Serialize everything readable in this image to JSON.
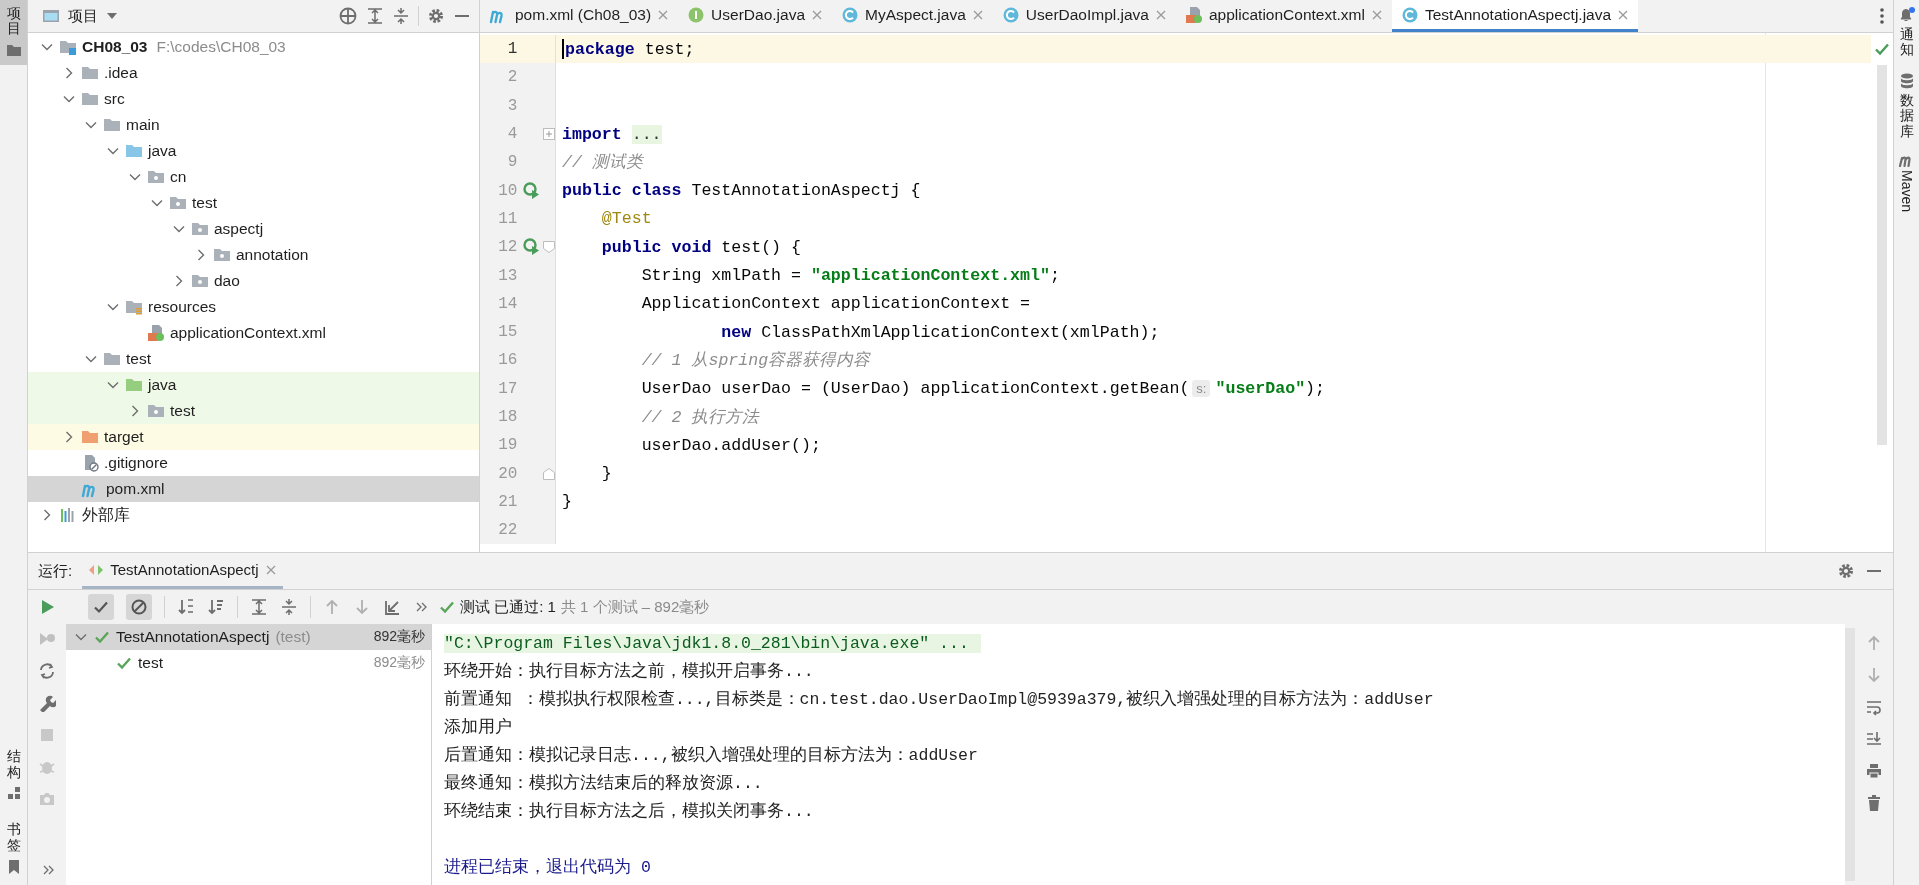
{
  "left_strip": {
    "top": [
      {
        "label": "项目",
        "selected": true
      }
    ],
    "bottom": [
      {
        "label": "结构",
        "kind": "structure",
        "selected": false
      },
      {
        "label": "书签",
        "kind": "bookmark",
        "selected": false
      }
    ]
  },
  "project": {
    "title": "项目",
    "tree": [
      {
        "label": "CH08_03",
        "hint": "F:\\codes\\CH08_03",
        "kind": "module",
        "expanded": true,
        "selected": false,
        "children": [
          {
            "label": ".idea",
            "kind": "folder",
            "expanded": false,
            "selected": false
          },
          {
            "label": "src",
            "kind": "folder",
            "expanded": true,
            "selected": false,
            "children": [
              {
                "label": "main",
                "kind": "folder",
                "expanded": true,
                "selected": false,
                "children": [
                  {
                    "label": "java",
                    "kind": "source-root",
                    "expanded": true,
                    "selected": false,
                    "children": [
                      {
                        "label": "cn",
                        "kind": "package",
                        "expanded": true,
                        "selected": false,
                        "children": [
                          {
                            "label": "test",
                            "kind": "package",
                            "expanded": true,
                            "selected": false,
                            "children": [
                              {
                                "label": "aspectj",
                                "kind": "package",
                                "expanded": true,
                                "selected": false,
                                "children": [
                                  {
                                    "label": "annotation",
                                    "kind": "package",
                                    "expanded": false,
                                    "selected": false
                                  }
                                ]
                              },
                              {
                                "label": "dao",
                                "kind": "package",
                                "expanded": false,
                                "selected": false
                              }
                            ]
                          }
                        ]
                      }
                    ]
                  },
                  {
                    "label": "resources",
                    "kind": "resources-root",
                    "expanded": true,
                    "selected": false,
                    "children": [
                      {
                        "label": "applicationContext.xml",
                        "kind": "spring-xml",
                        "selected": false
                      }
                    ]
                  }
                ]
              },
              {
                "label": "test",
                "kind": "folder",
                "expanded": true,
                "selected": false,
                "children": [
                  {
                    "label": "java",
                    "kind": "test-root",
                    "test_source": true,
                    "expanded": true,
                    "selected": false,
                    "children": [
                      {
                        "label": "test",
                        "kind": "package",
                        "test_source": true,
                        "expanded": false,
                        "selected": false
                      }
                    ]
                  }
                ]
              }
            ]
          },
          {
            "label": "target",
            "kind": "excluded",
            "excluded": true,
            "expanded": false,
            "selected": false
          },
          {
            "label": ".gitignore",
            "kind": "gitignore",
            "selected": false
          },
          {
            "label": "pom.xml",
            "kind": "maven",
            "selected": true
          }
        ]
      },
      {
        "label": "外部库",
        "kind": "library",
        "expanded": false,
        "selected": false
      }
    ]
  },
  "editor": {
    "tabs": [
      {
        "label": "pom.xml (Ch08_03)",
        "kind": "maven",
        "selected": false
      },
      {
        "label": "UserDao.java",
        "kind": "interface",
        "selected": false
      },
      {
        "label": "MyAspect.java",
        "kind": "class",
        "selected": false
      },
      {
        "label": "UserDaoImpl.java",
        "kind": "class",
        "selected": false
      },
      {
        "label": "applicationContext.xml",
        "kind": "spring-xml",
        "selected": false
      },
      {
        "label": "TestAnnotationAspectj.java",
        "kind": "class",
        "selected": true
      }
    ],
    "lines": [
      {
        "number": "1",
        "current": true,
        "tokens": [
          {
            "kind": "keyword",
            "text": "package"
          },
          {
            "kind": "plain",
            "text": " test;"
          }
        ]
      },
      {
        "number": "2",
        "current": false
      },
      {
        "number": "3",
        "current": false
      },
      {
        "number": "4",
        "current": false,
        "folded": true,
        "tokens": [
          {
            "kind": "keyword",
            "text": "import"
          },
          {
            "kind": "folded",
            "text": " ..."
          }
        ]
      },
      {
        "number": "9",
        "current": false,
        "tokens": [
          {
            "kind": "comment",
            "text": "// 测试类"
          }
        ]
      },
      {
        "number": "10",
        "current": false,
        "runnable": true,
        "tokens": [
          {
            "kind": "keyword",
            "text": "public class"
          },
          {
            "kind": "plain",
            "text": " TestAnnotationAspectj {"
          }
        ]
      },
      {
        "number": "11",
        "current": false,
        "tokens": [
          {
            "kind": "annotation",
            "text": "    @Test"
          }
        ]
      },
      {
        "number": "12",
        "current": false,
        "runnable": true,
        "fold_start": true,
        "tokens": [
          {
            "kind": "keyword",
            "text": "    public void"
          },
          {
            "kind": "plain",
            "text": " test() {"
          }
        ]
      },
      {
        "number": "13",
        "current": false,
        "tokens": [
          {
            "kind": "plain",
            "text": "        String xmlPath = "
          },
          {
            "kind": "string",
            "text": "\"applicationContext.xml\""
          },
          {
            "kind": "plain",
            "text": ";"
          }
        ]
      },
      {
        "number": "14",
        "current": false,
        "tokens": [
          {
            "kind": "plain",
            "text": "        ApplicationContext applicationContext ="
          }
        ]
      },
      {
        "number": "15",
        "current": false,
        "tokens": [
          {
            "kind": "keyword",
            "text": "                new"
          },
          {
            "kind": "plain",
            "text": " ClassPathXmlApplicationContext(xmlPath);"
          }
        ]
      },
      {
        "number": "16",
        "current": false,
        "tokens": [
          {
            "kind": "comment",
            "text": "        // 1 从spring容器获得内容"
          }
        ]
      },
      {
        "number": "17",
        "current": false,
        "tokens": [
          {
            "kind": "plain",
            "text": "        UserDao userDao = (UserDao) applicationContext.getBean("
          },
          {
            "kind": "hint",
            "text": "s:"
          },
          {
            "kind": "string",
            "text": "\"userDao\""
          },
          {
            "kind": "plain",
            "text": ");"
          }
        ]
      },
      {
        "number": "18",
        "current": false,
        "tokens": [
          {
            "kind": "comment",
            "text": "        // 2 执行方法"
          }
        ]
      },
      {
        "number": "19",
        "current": false,
        "tokens": [
          {
            "kind": "plain",
            "text": "        userDao.addUser();"
          }
        ]
      },
      {
        "number": "20",
        "current": false,
        "fold_end": true,
        "tokens": [
          {
            "kind": "plain",
            "text": "    }"
          }
        ]
      },
      {
        "number": "21",
        "current": false,
        "tokens": [
          {
            "kind": "plain",
            "text": "}"
          }
        ]
      },
      {
        "number": "22",
        "current": false
      }
    ]
  },
  "run": {
    "label": "运行:",
    "tabs": [
      {
        "label": "TestAnnotationAspectj",
        "selected": true
      }
    ],
    "toggles": [
      {
        "kind": "passed",
        "on": true
      },
      {
        "kind": "ignored",
        "on": true
      }
    ],
    "status": {
      "passed": "测试 已通过: 1",
      "summary": "共 1 个测试 – 892毫秒"
    },
    "tests": [
      {
        "label": "TestAnnotationAspectj",
        "hint": "(test)",
        "time": "892毫秒",
        "passed": true,
        "expanded": true,
        "selected": true,
        "children": [
          {
            "label": "test",
            "time": "892毫秒",
            "passed": true,
            "selected": false
          }
        ]
      }
    ],
    "console": [
      {
        "kind": "command",
        "text": "\"C:\\Program Files\\Java\\jdk1.8.0_281\\bin\\java.exe\" ..."
      },
      {
        "kind": "output",
        "text": "环绕开始：执行目标方法之前，模拟开启事务..."
      },
      {
        "kind": "output",
        "text": "前置通知 ：模拟执行权限检查...,目标类是：cn.test.dao.UserDaoImpl@5939a379,被织入增强处理的目标方法为：addUser"
      },
      {
        "kind": "output",
        "text": "添加用户"
      },
      {
        "kind": "output",
        "text": "后置通知：模拟记录日志...,被织入增强处理的目标方法为：addUser"
      },
      {
        "kind": "output",
        "text": "最终通知：模拟方法结束后的释放资源..."
      },
      {
        "kind": "output",
        "text": "环绕结束：执行目标方法之后，模拟关闭事务..."
      },
      {
        "kind": "exit",
        "text": "进程已结束，退出代码为 0"
      }
    ]
  },
  "right_strip": [
    {
      "label": "通知",
      "kind": "bell",
      "unread": true
    },
    {
      "label": "数据库",
      "kind": "database"
    },
    {
      "label": "Maven",
      "kind": "maven"
    }
  ]
}
